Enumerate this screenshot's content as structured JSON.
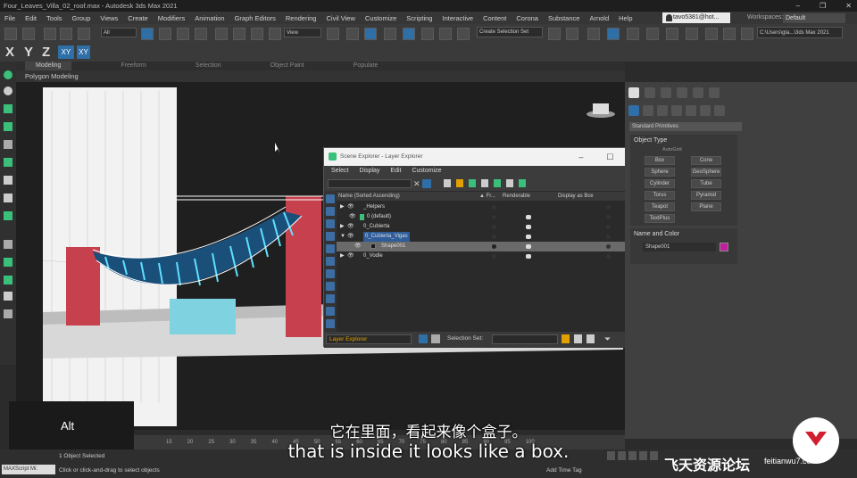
{
  "window": {
    "title": "Four_Leaves_Villa_02_roof.max - Autodesk 3ds Max 2021"
  },
  "menu": [
    "File",
    "Edit",
    "Tools",
    "Group",
    "Views",
    "Create",
    "Modifiers",
    "Animation",
    "Graph Editors",
    "Rendering",
    "Civil View",
    "Customize",
    "Scripting",
    "Interactive",
    "Content",
    "Corona",
    "Substance",
    "Arnold",
    "Help"
  ],
  "user": {
    "name": "tavo5381@hot..."
  },
  "workspace": {
    "label": "Workspaces:",
    "value": "Default"
  },
  "toolbar": {
    "filter": "All",
    "view": "View",
    "selection_set": "Create Selection Set",
    "path": "C:\\Users\\gta...\\3ds Max 2021"
  },
  "axes": {
    "x": "X",
    "y": "Y",
    "z": "Z",
    "xy": "XY",
    "xy2": "XY"
  },
  "ribbon": {
    "tabs": [
      "Modeling",
      "Freeform",
      "Selection",
      "Object Paint",
      "Populate"
    ],
    "active": "Modeling",
    "sub": "Polygon Modeling"
  },
  "scene_explorer": {
    "title": "Scene Explorer - Layer Explorer",
    "menu": [
      "Select",
      "Display",
      "Edit",
      "Customize"
    ],
    "columns": {
      "name": "Name (Sorted Ascending)",
      "frozen": "▲ Fr...",
      "renderable": "Renderable",
      "display_box": "Display as Box"
    },
    "rows": [
      {
        "name": "_Helpers",
        "indent": 0
      },
      {
        "name": "0 (default)",
        "indent": 1
      },
      {
        "name": "0_Cubierta",
        "indent": 0
      },
      {
        "name": "0_Cubierta_Vigas",
        "indent": 0
      },
      {
        "name": "Shape001",
        "indent": 2
      },
      {
        "name": "0_Vodle",
        "indent": 0
      }
    ],
    "layer_dropdown": "Layer Explorer",
    "selection_set_label": "Selection Set:"
  },
  "command_panel": {
    "dropdown": "Standard Primitives",
    "object_type": "Object Type",
    "autogrid": "AutoGrid",
    "buttons": [
      "Box",
      "Cone",
      "Sphere",
      "GeoSphere",
      "Cylinder",
      "Tube",
      "Torus",
      "Pyramid",
      "Teapot",
      "Plane",
      "TextPlus"
    ],
    "name_color": "Name and Color",
    "object_name": "Shape001",
    "swatch_color": "#c21f9e"
  },
  "status": {
    "maxscript": "MAXScript Mi:",
    "selected": "1 Object Selected",
    "hint": "Click or click-and-drag to select objects",
    "time_tag": "Add Time Tag"
  },
  "overlay": {
    "key": "Alt",
    "subtitle_cn": "它在里面，看起来像个盒子。",
    "subtitle_en": "that is inside it looks like a box.",
    "watermark": "飞天资源论坛",
    "watermark_url": "feitianwu7.com"
  },
  "trackbar_ticks": [
    "15",
    "20",
    "25",
    "30",
    "35",
    "40",
    "45",
    "50",
    "55",
    "60",
    "65",
    "70",
    "75",
    "80",
    "85",
    "90",
    "95",
    "100"
  ]
}
